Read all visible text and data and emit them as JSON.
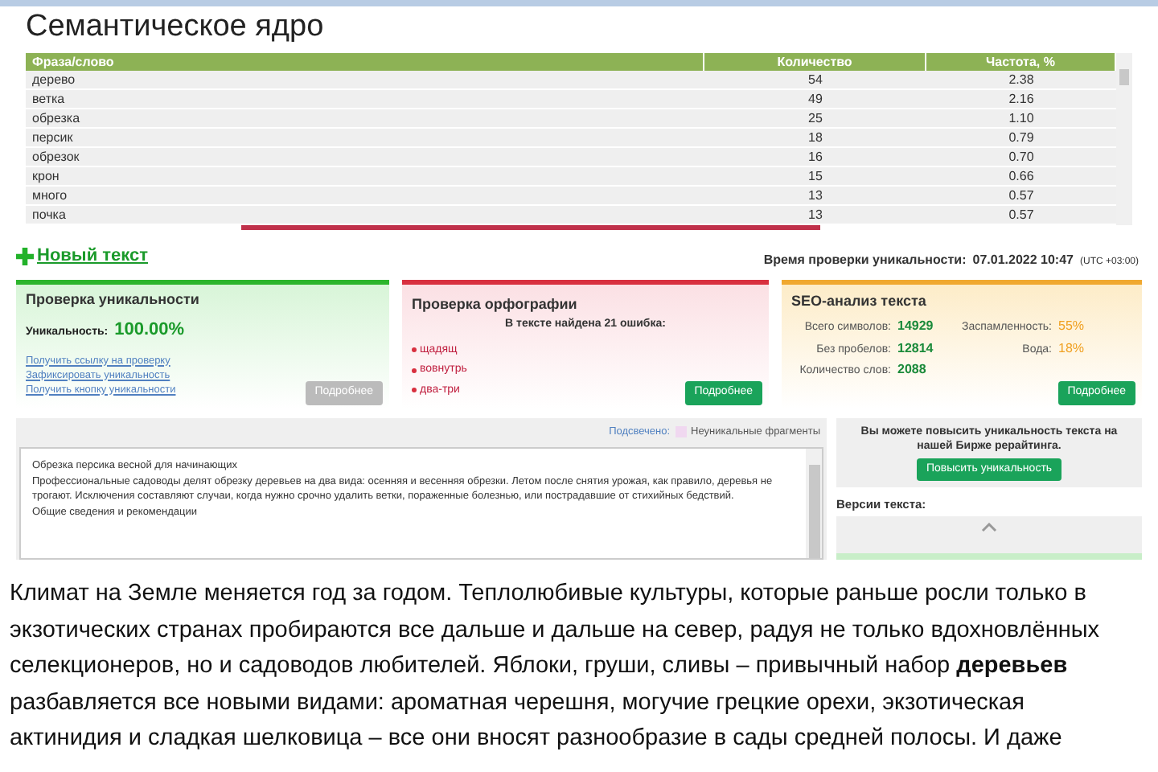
{
  "semantic_core": {
    "title": "Семантическое ядро",
    "columns": [
      "Фраза/слово",
      "Количество",
      "Частота, %"
    ],
    "rows": [
      [
        "дерево",
        "54",
        "2.38"
      ],
      [
        "ветка",
        "49",
        "2.16"
      ],
      [
        "обрезка",
        "25",
        "1.10"
      ],
      [
        "персик",
        "18",
        "0.79"
      ],
      [
        "обрезок",
        "16",
        "0.70"
      ],
      [
        "крон",
        "15",
        "0.66"
      ],
      [
        "много",
        "13",
        "0.57"
      ],
      [
        "почка",
        "13",
        "0.57"
      ]
    ]
  },
  "checker": {
    "new_text": "Новый текст",
    "check_time_label": "Время проверки уникальности:",
    "check_time": "07.01.2022 10:47",
    "timezone": "(UTC +03:00)",
    "uniqueness": {
      "title": "Проверка уникальности",
      "label": "Уникальность:",
      "value": "100.00%",
      "links": [
        "Получить ссылку на проверку",
        "Зафиксировать уникальность",
        "Получить кнопку уникальности"
      ],
      "button": {
        "label": "Подробнее",
        "disabled": true
      }
    },
    "spelling": {
      "title": "Проверка орфографии",
      "summary": "В тексте найдена 21 ошибка:",
      "errors": [
        "щадящ",
        "вовнутрь",
        "два-три"
      ],
      "button": {
        "label": "Подробнее",
        "disabled": false
      }
    },
    "seo": {
      "title": "SEO-анализ текста",
      "stats": [
        {
          "label": "Всего символов:",
          "value": "14929",
          "kind": "count"
        },
        {
          "label": "Заспамленность:",
          "value": "55%",
          "kind": "percent"
        },
        {
          "label": "Без пробелов:",
          "value": "12814",
          "kind": "count"
        },
        {
          "label": "Вода:",
          "value": "18%",
          "kind": "percent"
        },
        {
          "label": "Количество слов:",
          "value": "2088",
          "kind": "count"
        }
      ],
      "button": {
        "label": "Подробнее",
        "disabled": false
      }
    },
    "highlight_label": "Подсвечено:",
    "legend": "Неуникальные фрагменты",
    "text_lines": [
      "Обрезка персика весной для начинающих",
      "Профессиональные садоводы делят обрезку деревьев на два вида: осенняя и весенняя обрезки. Летом после снятия урожая, как правило, деревья не трогают. Исключения составляют случаи, когда нужно срочно удалить ветки, пораженные болезнью, или пострадавшие от стихийных бедствий.",
      "Общие сведения и рекомендации"
    ],
    "promo": {
      "text": "Вы можете повысить уникальность текста на нашей Бирже рерайтинга.",
      "button": "Повысить уникальность"
    },
    "versions_title": "Версии текста:"
  },
  "article": "Климат на Земле меняется год за годом. Теплолюбивые культуры, которые раньше росли только в экзотических странах пробираются все дальше и дальше на север, радуя не только вдохновлённых селекционеров, но и садоводов любителей. Яблоки, груши, сливы – привычный набор **деревьев** разбавляется все новыми видами: ароматная черешня, могучие грецкие орехи, экзотическая актинидия и сладкая шелковица – все они вносят разнообразие в сады средней полосы. И даже"
}
